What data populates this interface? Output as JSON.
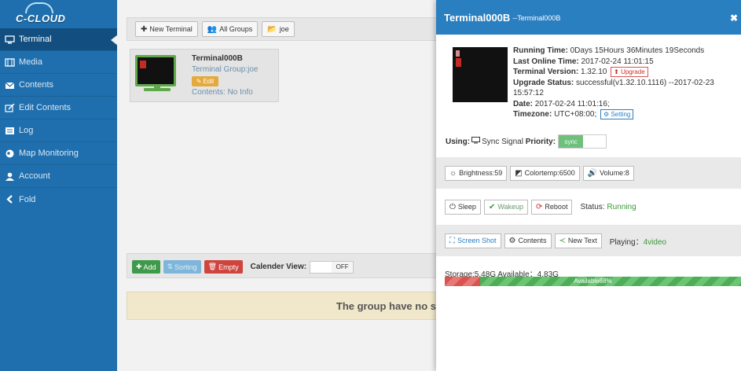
{
  "sidebar": {
    "logo": "C-CLOUD",
    "items": [
      {
        "label": "Terminal",
        "icon": "monitor-icon"
      },
      {
        "label": "Media",
        "icon": "film-icon"
      },
      {
        "label": "Contents",
        "icon": "envelope-icon"
      },
      {
        "label": "Edit Contents",
        "icon": "edit-icon"
      },
      {
        "label": "Log",
        "icon": "log-icon"
      },
      {
        "label": "Map Monitoring",
        "icon": "globe-icon"
      },
      {
        "label": "Account",
        "icon": "user-icon"
      },
      {
        "label": "Fold",
        "icon": "chevron-left-icon"
      }
    ]
  },
  "toolbar": {
    "new_terminal": "New Terminal",
    "all_groups": "All Groups",
    "group": "joe"
  },
  "terminal_card": {
    "name": "Terminal000B",
    "group": "Terminal Group:joe",
    "edit": "Edit",
    "contents": "Contents: No Info"
  },
  "schedule": {
    "add": "Add",
    "sorting": "Sorting",
    "empty": "Empty",
    "calendar_label": "Calender View:",
    "calendar_state": "OFF",
    "no_schedule": "The group have no schedule"
  },
  "panel": {
    "title": "Terminal000B",
    "subtitle": "--Terminal000B",
    "running_time_label": "Running Time:",
    "running_time": "0Days 15Hours 36Minutes 19Seconds",
    "last_online_label": "Last Online Time:",
    "last_online": "2017-02-24 11:01:15",
    "version_label": "Terminal Version:",
    "version": "1.32.10",
    "upgrade_btn": "Upgrade",
    "upgrade_status_label": "Upgrade Status:",
    "upgrade_status": "successful(v1.32.10.1116) --2017-02-23 15:57:12",
    "date_label": "Date:",
    "date": "2017-02-24 11:01:16;",
    "timezone_label": "Timezone:",
    "timezone": "UTC+08:00;",
    "setting_btn": "Setting",
    "using_label": "Using:",
    "sync_label": "Sync Signal",
    "priority_label": "Priority:",
    "priority_toggle": "sync",
    "brightness": "Brightness:59",
    "colortemp": "Colortemp:6500",
    "volume": "Volume:8",
    "sleep": "Sleep",
    "wakeup": "Wakeup",
    "reboot": "Reboot",
    "status_label": "Status:",
    "status": "Running",
    "screenshot": "Screen Shot",
    "contents": "Contents",
    "new_text": "New Text",
    "playing_label": "Playing：",
    "playing": "4video",
    "storage": "Storage:5.48G Available：4.83G",
    "available": "Available88%",
    "available_fraction": 0.88
  },
  "colors": {
    "sidebar": "#1f6fae",
    "panel_header": "#2a7fc1",
    "running": "#3a9a3a"
  }
}
